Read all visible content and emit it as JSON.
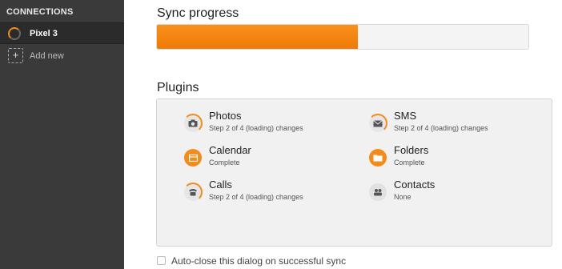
{
  "sidebar": {
    "title": "CONNECTIONS",
    "device": {
      "label": "Pixel 3"
    },
    "add_label": "Add new",
    "add_symbol": "+"
  },
  "sync": {
    "title": "Sync progress",
    "progress": 0.54
  },
  "plugins": {
    "title": "Plugins",
    "items": [
      {
        "name": "Photos",
        "status": "Step 2 of 4 (loading) changes",
        "icon": "camera-icon",
        "state": "loading"
      },
      {
        "name": "SMS",
        "status": "Step 2 of 4 (loading) changes",
        "icon": "envelope-icon",
        "state": "loading"
      },
      {
        "name": "Calendar",
        "status": "Complete",
        "icon": "calendar-icon",
        "state": "complete"
      },
      {
        "name": "Folders",
        "status": "Complete",
        "icon": "folder-icon",
        "state": "complete"
      },
      {
        "name": "Calls",
        "status": "Step 2 of 4 (loading) changes",
        "icon": "phone-icon",
        "state": "loading"
      },
      {
        "name": "Contacts",
        "status": "None",
        "icon": "contacts-icon",
        "state": "none"
      }
    ]
  },
  "autoclose": {
    "label": "Auto-close this dialog on successful sync",
    "checked": false
  },
  "colors": {
    "accent": "#f28c1c",
    "sidebar": "#3a3a3a"
  }
}
